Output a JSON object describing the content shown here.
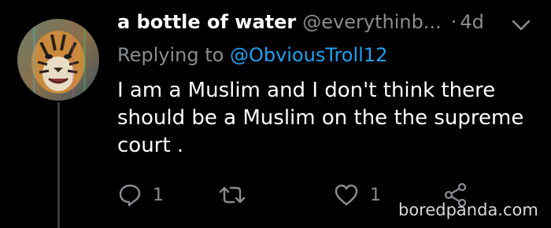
{
  "tweet": {
    "display_name": "a bottle of water",
    "handle": "@everythinb...",
    "separator": "·",
    "time": "4d",
    "replying_prefix": "Replying to ",
    "replying_mention": "@ObviousTroll12",
    "body_lines": [
      "I am a Muslim and I don't think there",
      "should be a Muslim on the the supreme",
      "court ."
    ]
  },
  "actions": {
    "reply_count": "1",
    "retweet_count": "",
    "like_count": "1"
  },
  "icons": {
    "reply": "reply-icon",
    "retweet": "retweet-icon",
    "like": "heart-icon",
    "share": "share-icon",
    "menu": "chevron-down-icon"
  },
  "watermark": "boredpanda.com",
  "colors": {
    "background": "#000000",
    "text_primary": "#ffffff",
    "text_secondary": "#8a8d91",
    "link": "#1da1f2"
  }
}
